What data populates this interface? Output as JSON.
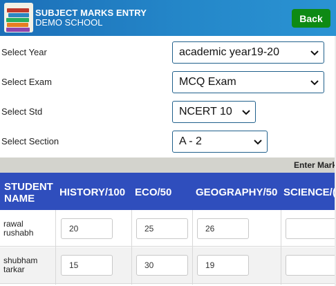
{
  "header": {
    "title": "SUBJECT MARKS ENTRY",
    "school": "DEMO SCHOOL",
    "back_label": "Back"
  },
  "form": {
    "year": {
      "label": "Select Year",
      "value": "academic year19-20"
    },
    "exam": {
      "label": "Select Exam",
      "value": "MCQ Exam"
    },
    "std": {
      "label": "Select Std",
      "value": "NCERT 10"
    },
    "section": {
      "label": "Select Section",
      "value": "A - 2"
    }
  },
  "enter_marks_text": "Enter Mark",
  "table": {
    "columns": [
      "STUDENT NAME",
      "HISTORY/100",
      "ECO/50",
      "GEOGRAPHY/50",
      "SCIENCE/("
    ],
    "rows": [
      {
        "name": "rawal rushabh",
        "marks": [
          "20",
          "25",
          "26",
          ""
        ]
      },
      {
        "name": "shubham tarkar",
        "marks": [
          "15",
          "30",
          "19",
          ""
        ]
      }
    ]
  },
  "colors": {
    "header_bg": "#2487c9",
    "back_button": "#0e8a14",
    "table_header": "#2f4ebd",
    "select_border": "#1f5f8b"
  }
}
